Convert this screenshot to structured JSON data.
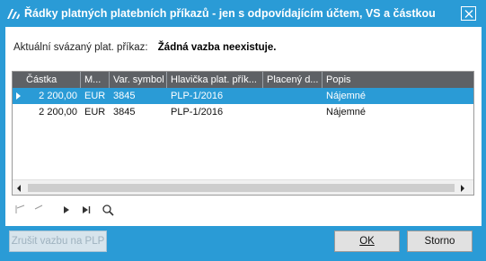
{
  "window": {
    "title": "Řádky platných platebních příkazů - jen s odpovídajícím účtem, VS a částkou",
    "accent_color": "#2a9bd6",
    "app_icon": "app-logo-icon",
    "close_icon": "close-icon"
  },
  "link_info": {
    "label": "Aktuální svázaný plat. příkaz:",
    "value": "Žádná vazba neexistuje."
  },
  "grid": {
    "columns": [
      "Částka",
      "M...",
      "Var. symbol",
      "Hlavička plat. přík...",
      "Placený d...",
      "Popis"
    ],
    "rows": [
      {
        "selected": true,
        "amount": "2 200,00",
        "currency": "EUR",
        "var_symbol": "3845",
        "header": "PLP-1/2016",
        "paid_date": "",
        "description": "Nájemné"
      },
      {
        "selected": false,
        "amount": "2 200,00",
        "currency": "EUR",
        "var_symbol": "3845",
        "header": "PLP-1/2016",
        "paid_date": "",
        "description": "Nájemné"
      }
    ],
    "scrollbar": {
      "left_arrow_icon": "scroll-left-icon",
      "right_arrow_icon": "scroll-right-icon"
    }
  },
  "navigator": {
    "icons": [
      "first-record-icon",
      "previous-record-icon",
      "next-record-icon",
      "last-record-icon",
      "search-icon"
    ]
  },
  "footer": {
    "unlink_label": "Zrušit vazbu na PLP",
    "ok_label": "OK",
    "cancel_label": "Storno"
  }
}
